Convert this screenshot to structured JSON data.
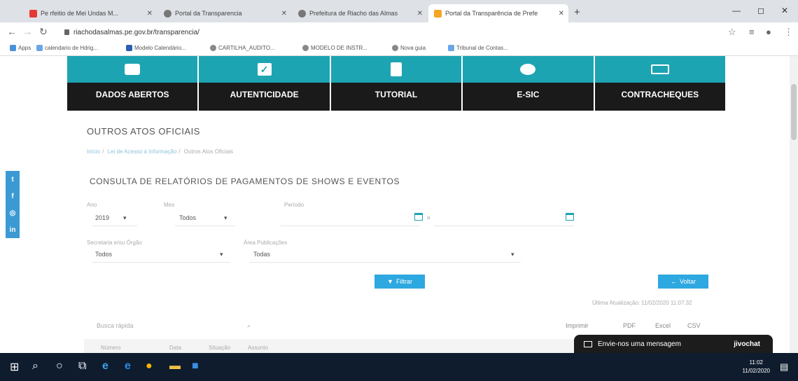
{
  "browser": {
    "tabs": [
      {
        "title": "Pe rfeitio de Mei Undas M...",
        "color": "#e53935"
      },
      {
        "title": "Portal da Transparencia",
        "color": "#777777"
      },
      {
        "title": "Prefeitura de Riacho das Almas",
        "color": "#777777"
      },
      {
        "title": "Portal da Transparência de Prefe",
        "color": "#f5a623"
      }
    ],
    "address": "riachodasalmas.pe.gov.br/transparencia/",
    "bookmarks": [
      "Apps",
      "calendario de Hdrig...",
      "Modelo Calendário...",
      "CARTILHA_AUDITO...",
      "MODELO DE INSTR...",
      "Nova guia",
      "Tribunal de Contas..."
    ]
  },
  "tiles": [
    {
      "label": "DADOS ABERTOS",
      "icon": "box-icon"
    },
    {
      "label": "AUTENTICIDADE",
      "icon": "checkbox-icon"
    },
    {
      "label": "TUTORIAL",
      "icon": "document-icon"
    },
    {
      "label": "E-SIC",
      "icon": "chat-icon"
    },
    {
      "label": "CONTRACHEQUES",
      "icon": "payslip-icon"
    }
  ],
  "page": {
    "heading": "OUTROS ATOS OFICIAIS",
    "breadcrumb": [
      "Início",
      "Lei de Acesso à Informação",
      "Outros Atos Oficiais"
    ],
    "section_title": "CONSULTA DE RELATÓRIOS DE PAGAMENTOS DE SHOWS E EVENTOS"
  },
  "filters": {
    "ano_label": "Ano",
    "ano_value": "2019",
    "mes_label": "Mes",
    "mes_value": "Todos",
    "periodo_label": "Período",
    "periodo_sep": "a",
    "secretaria_label": "Secretaria e/ou Órgão",
    "secretaria_value": "Todos",
    "area_label": "Área Publicações",
    "area_value": "Todas",
    "filter_button": "Filtrar",
    "back_button": "Voltar"
  },
  "update_text": "Última Atualização: 11/02/2020 11:07:32",
  "table": {
    "search_label": "Busca rápida",
    "export": [
      "Imprimir",
      "PDF",
      "Excel",
      "CSV"
    ],
    "columns": [
      "Número",
      "Data",
      "Situação",
      "Assunto"
    ]
  },
  "social": [
    "t",
    "f",
    "◎",
    "in"
  ],
  "chat": {
    "label": "Envie-nos uma mensagem",
    "brand": "jivochat"
  },
  "taskbar": {
    "time": "11:02",
    "date": "11/02/2020"
  }
}
